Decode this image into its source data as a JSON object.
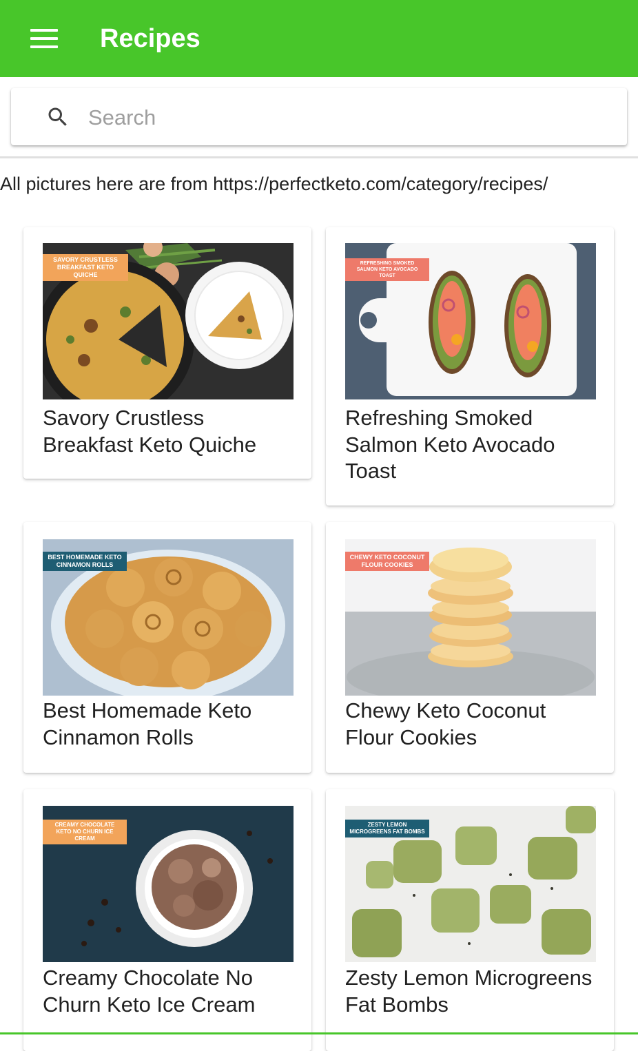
{
  "appbar": {
    "title": "Recipes",
    "color": "#48c62a",
    "menu_icon": "menu-icon"
  },
  "search": {
    "placeholder": "Search",
    "value": "",
    "icon": "search-icon"
  },
  "credit_text": "All pictures here are from https://perfectketo.com/category/recipes/",
  "recipes": [
    {
      "title": "Savory Crustless Breakfast Keto Quiche",
      "tag": "SAVORY CRUSTLESS BREAKFAST KETO QUICHE",
      "tag_color": "#f2a45a"
    },
    {
      "title": "Refreshing Smoked Salmon Keto Avocado Toast",
      "tag": "REFRESHING SMOKED SALMON KETO AVOCADO TOAST",
      "tag_color": "#ee7a6a"
    },
    {
      "title": "Best Homemade Keto Cinnamon Rolls",
      "tag": "BEST HOMEMADE KETO CINNAMON ROLLS",
      "tag_color": "#1e5d73"
    },
    {
      "title": "Chewy Keto Coconut Flour Cookies",
      "tag": "CHEWY KETO COCONUT FLOUR COOKIES",
      "tag_color": "#ee7a6a"
    },
    {
      "title": "Creamy Chocolate No Churn Keto Ice Cream",
      "tag": "CREAMY CHOCOLATE KETO NO CHURN ICE CREAM",
      "tag_color": "#f2a45a"
    },
    {
      "title": "Zesty Lemon Microgreens Fat Bombs",
      "tag": "ZESTY LEMON MICROGREENS FAT BOMBS",
      "tag_color": "#1e5d73"
    }
  ]
}
